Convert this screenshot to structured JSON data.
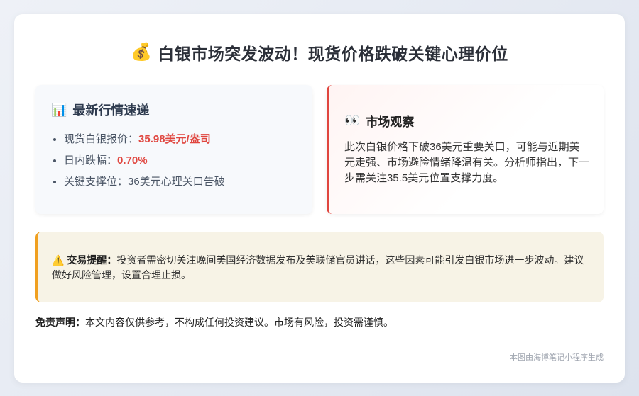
{
  "title": {
    "icon": "money-bag-icon",
    "text": "白银市场突发波动！现货价格跌破关键心理价位"
  },
  "market": {
    "icon": "bar-chart-icon",
    "heading": "最新行情速递",
    "items": [
      {
        "label": "现货白银报价：",
        "value": "35.98美元/盎司",
        "highlight": true
      },
      {
        "label": "日内跌幅：",
        "value": "0.70%",
        "highlight": true
      },
      {
        "label": "关键支撑位：",
        "value": "36美元心理关口告破",
        "highlight": false
      }
    ]
  },
  "observation": {
    "icon": "eyes-icon",
    "heading": "市场观察",
    "text": "此次白银价格下破36美元重要关口，可能与近期美元走强、市场避险情绪降温有关。分析师指出，下一步需关注35.5美元位置支撑力度。"
  },
  "tip": {
    "icon": "warning-icon",
    "label": "交易提醒：",
    "text": "投资者需密切关注晚间美国经济数据发布及美联储官员讲话，这些因素可能引发白银市场进一步波动。建议做好风险管理，设置合理止损。"
  },
  "disclaimer": {
    "label": "免责声明：",
    "text": "本文内容仅供参考，不构成任何投资建议。市场有风险，投资需谨慎。"
  },
  "footer": "本图由海博笔记小程序生成",
  "colors": {
    "accent_red": "#e0463f",
    "accent_orange": "#f0a020"
  }
}
